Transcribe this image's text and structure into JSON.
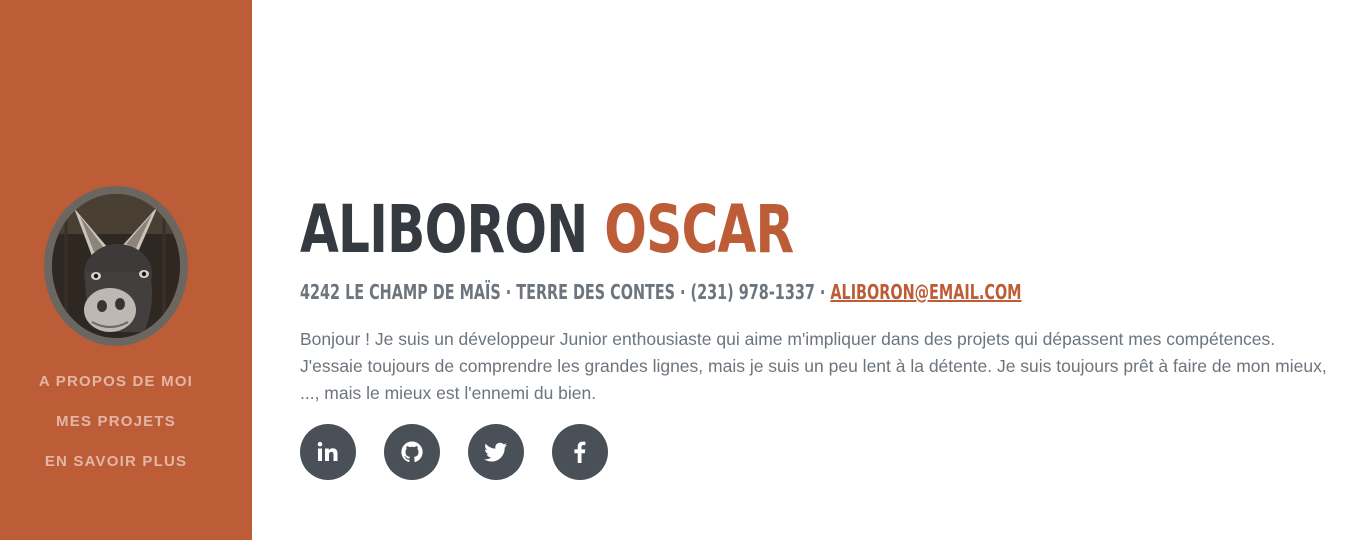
{
  "nav": {
    "items": [
      {
        "label": "A PROPOS DE MOI"
      },
      {
        "label": "MES PROJETS"
      },
      {
        "label": "EN SAVOIR PLUS"
      }
    ]
  },
  "header": {
    "first_name": "ALIBORON",
    "last_name": "OSCAR"
  },
  "contact": {
    "address": "4242 LE CHAMP DE MAÏS · TERRE DES CONTES · (231) 978-1337 ·",
    "email": "ALIBORON@EMAIL.COM"
  },
  "bio": "Bonjour ! Je suis un développeur Junior enthousiaste qui aime m'impliquer dans des projets qui dépassent mes compétences. J'essaie toujours de comprendre les grandes lignes, mais je suis un peu lent à la détente. Je suis toujours prêt à faire de mon mieux, ..., mais le mieux est l'ennemi du bien.",
  "social": [
    {
      "icon": "linkedin-icon"
    },
    {
      "icon": "github-icon"
    },
    {
      "icon": "twitter-icon"
    },
    {
      "icon": "facebook-icon"
    }
  ],
  "colors": {
    "primary": "#bd5d38",
    "dark": "#343a40",
    "muted": "#6c757d",
    "icon_bg": "#495057"
  }
}
